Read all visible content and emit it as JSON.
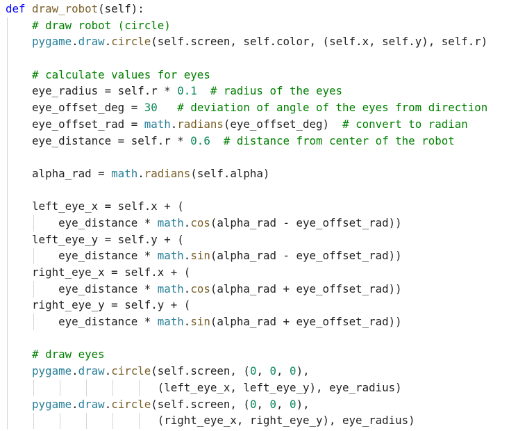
{
  "editor": {
    "lines": [
      [
        {
          "t": "def ",
          "c": "kw"
        },
        {
          "t": "draw_robot",
          "c": "fn"
        },
        {
          "t": "(self):",
          "c": "text"
        }
      ],
      [
        {
          "t": "    # draw robot (circle)",
          "c": "cm"
        }
      ],
      [
        {
          "t": "    ",
          "c": "text"
        },
        {
          "t": "pygame",
          "c": "mod"
        },
        {
          "t": ".",
          "c": "text"
        },
        {
          "t": "draw",
          "c": "mod"
        },
        {
          "t": ".",
          "c": "text"
        },
        {
          "t": "circle",
          "c": "fn"
        },
        {
          "t": "(self.screen, self.color, (self.x, self.y), self.r)",
          "c": "text"
        }
      ],
      [],
      [
        {
          "t": "    # calculate values for eyes",
          "c": "cm"
        }
      ],
      [
        {
          "t": "    eye_radius = self.r * ",
          "c": "text"
        },
        {
          "t": "0.1",
          "c": "num"
        },
        {
          "t": "  # radius of the eyes",
          "c": "cm"
        }
      ],
      [
        {
          "t": "    eye_offset_deg = ",
          "c": "text"
        },
        {
          "t": "30",
          "c": "num"
        },
        {
          "t": "   # deviation of angle of the eyes from direction",
          "c": "cm"
        }
      ],
      [
        {
          "t": "    eye_offset_rad = ",
          "c": "text"
        },
        {
          "t": "math",
          "c": "mod"
        },
        {
          "t": ".",
          "c": "text"
        },
        {
          "t": "radians",
          "c": "fn"
        },
        {
          "t": "(eye_offset_deg)  ",
          "c": "text"
        },
        {
          "t": "# convert to radian",
          "c": "cm"
        }
      ],
      [
        {
          "t": "    eye_distance = self.r * ",
          "c": "text"
        },
        {
          "t": "0.6",
          "c": "num"
        },
        {
          "t": "  # distance from center of the robot",
          "c": "cm"
        }
      ],
      [],
      [
        {
          "t": "    alpha_rad = ",
          "c": "text"
        },
        {
          "t": "math",
          "c": "mod"
        },
        {
          "t": ".",
          "c": "text"
        },
        {
          "t": "radians",
          "c": "fn"
        },
        {
          "t": "(self.alpha)",
          "c": "text"
        }
      ],
      [],
      [
        {
          "t": "    left_eye_x = self.x + (",
          "c": "text"
        }
      ],
      [
        {
          "t": "        eye_distance * ",
          "c": "text"
        },
        {
          "t": "math",
          "c": "mod"
        },
        {
          "t": ".",
          "c": "text"
        },
        {
          "t": "cos",
          "c": "fn"
        },
        {
          "t": "(alpha_rad - eye_offset_rad))",
          "c": "text"
        }
      ],
      [
        {
          "t": "    left_eye_y = self.y + (",
          "c": "text"
        }
      ],
      [
        {
          "t": "        eye_distance * ",
          "c": "text"
        },
        {
          "t": "math",
          "c": "mod"
        },
        {
          "t": ".",
          "c": "text"
        },
        {
          "t": "sin",
          "c": "fn"
        },
        {
          "t": "(alpha_rad - eye_offset_rad))",
          "c": "text"
        }
      ],
      [
        {
          "t": "    right_eye_x = self.x + (",
          "c": "text"
        }
      ],
      [
        {
          "t": "        eye_distance * ",
          "c": "text"
        },
        {
          "t": "math",
          "c": "mod"
        },
        {
          "t": ".",
          "c": "text"
        },
        {
          "t": "cos",
          "c": "fn"
        },
        {
          "t": "(alpha_rad + eye_offset_rad))",
          "c": "text"
        }
      ],
      [
        {
          "t": "    right_eye_y = self.y + (",
          "c": "text"
        }
      ],
      [
        {
          "t": "        eye_distance * ",
          "c": "text"
        },
        {
          "t": "math",
          "c": "mod"
        },
        {
          "t": ".",
          "c": "text"
        },
        {
          "t": "sin",
          "c": "fn"
        },
        {
          "t": "(alpha_rad + eye_offset_rad))",
          "c": "text"
        }
      ],
      [],
      [
        {
          "t": "    # draw eyes",
          "c": "cm"
        }
      ],
      [
        {
          "t": "    ",
          "c": "text"
        },
        {
          "t": "pygame",
          "c": "mod"
        },
        {
          "t": ".",
          "c": "text"
        },
        {
          "t": "draw",
          "c": "mod"
        },
        {
          "t": ".",
          "c": "text"
        },
        {
          "t": "circle",
          "c": "fn"
        },
        {
          "t": "(self.screen, (",
          "c": "text"
        },
        {
          "t": "0",
          "c": "num"
        },
        {
          "t": ", ",
          "c": "text"
        },
        {
          "t": "0",
          "c": "num"
        },
        {
          "t": ", ",
          "c": "text"
        },
        {
          "t": "0",
          "c": "num"
        },
        {
          "t": "),",
          "c": "text"
        }
      ],
      [
        {
          "t": "                       (left_eye_x, left_eye_y), eye_radius)",
          "c": "text"
        }
      ],
      [
        {
          "t": "    ",
          "c": "text"
        },
        {
          "t": "pygame",
          "c": "mod"
        },
        {
          "t": ".",
          "c": "text"
        },
        {
          "t": "draw",
          "c": "mod"
        },
        {
          "t": ".",
          "c": "text"
        },
        {
          "t": "circle",
          "c": "fn"
        },
        {
          "t": "(self.screen, (",
          "c": "text"
        },
        {
          "t": "0",
          "c": "num"
        },
        {
          "t": ", ",
          "c": "text"
        },
        {
          "t": "0",
          "c": "num"
        },
        {
          "t": ", ",
          "c": "text"
        },
        {
          "t": "0",
          "c": "num"
        },
        {
          "t": "),",
          "c": "text"
        }
      ],
      [
        {
          "t": "                       (right_eye_x, right_eye_y), eye_radius)",
          "c": "text"
        }
      ]
    ]
  }
}
